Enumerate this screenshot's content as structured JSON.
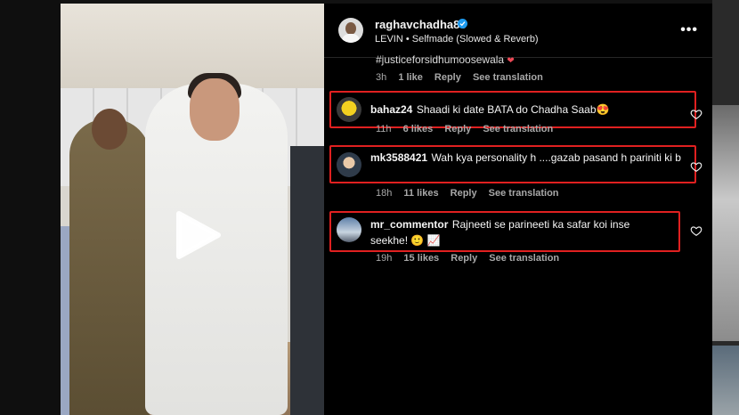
{
  "post": {
    "username": "raghavchadha88",
    "audio": "LEVIN • Selfmade (Slowed & Reverb)",
    "more_label": "•••"
  },
  "prev_comment": {
    "clipped_text": "#justiceforsidhumoosewala",
    "time": "3h",
    "likes": "1 like",
    "reply": "Reply",
    "translate": "See translation"
  },
  "comments": [
    {
      "username": "bahaz24",
      "text": "Shaadi ki date BATA do Chadha Saab😍",
      "time": "11h",
      "likes": "6 likes",
      "reply": "Reply",
      "translate": "See translation"
    },
    {
      "username": "mk3588421",
      "text": "Wah kya personality h ....gazab pasand h pariniti ki b",
      "time": "18h",
      "likes": "11 likes",
      "reply": "Reply",
      "translate": "See translation"
    },
    {
      "username": "mr_commentor",
      "text": "Rajneeti se parineeti ka safar koi inse seekhe! 🙂 📈",
      "time": "19h",
      "likes": "15 likes",
      "reply": "Reply",
      "translate": "See translation"
    }
  ],
  "icons": {
    "play": "play-icon",
    "verified": "verified-badge-icon",
    "like": "heart-outline-icon",
    "more": "more-options-icon"
  },
  "colors": {
    "highlight_border": "#e02020",
    "verified": "#1d9bf0",
    "meta_text": "#a8a8a8"
  }
}
